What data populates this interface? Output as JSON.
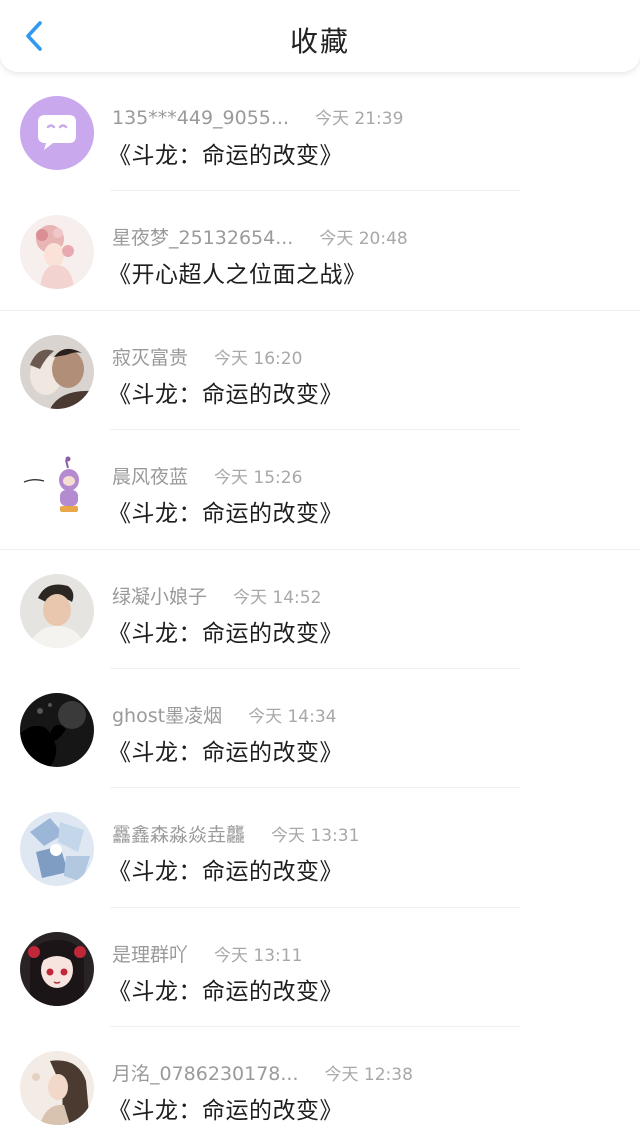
{
  "header": {
    "title": "收藏",
    "back_icon": "chevron-left-icon",
    "accent": "#2f9af0"
  },
  "items": [
    {
      "username": "135***449_9055...",
      "time": "今天 21:39",
      "title": "《斗龙：命运的改变》",
      "avatar_icon": "chat-bubble-avatar"
    },
    {
      "username": "星夜梦_25132654...",
      "time": "今天 20:48",
      "title": "《开心超人之位面之战》",
      "avatar_icon": "girl-illustration-avatar"
    },
    {
      "username": "寂灭富贵",
      "time": "今天 16:20",
      "title": "《斗龙：命运的改变》",
      "avatar_icon": "couple-photo-avatar"
    },
    {
      "username": "晨风夜蓝",
      "time": "今天 15:26",
      "title": "《斗龙：命运的改变》",
      "avatar_icon": "cartoon-character-avatar"
    },
    {
      "username": "绿凝小娘子",
      "time": "今天 14:52",
      "title": "《斗龙：命运的改变》",
      "avatar_icon": "boy-photo-avatar"
    },
    {
      "username": "ghost墨凌烟",
      "time": "今天 14:34",
      "title": "《斗龙：命运的改变》",
      "avatar_icon": "silhouette-avatar"
    },
    {
      "username": "靐鑫森淼焱垚龘",
      "time": "今天 13:31",
      "title": "《斗龙：命运的改变》",
      "avatar_icon": "anime-blue-avatar"
    },
    {
      "username": "是理群吖",
      "time": "今天 13:11",
      "title": "《斗龙：命运的改变》",
      "avatar_icon": "anime-girl-avatar"
    },
    {
      "username": "月洺_0786230178...",
      "time": "今天 12:38",
      "title": "《斗龙：命运的改变》",
      "avatar_icon": "girl-photo-avatar"
    }
  ]
}
